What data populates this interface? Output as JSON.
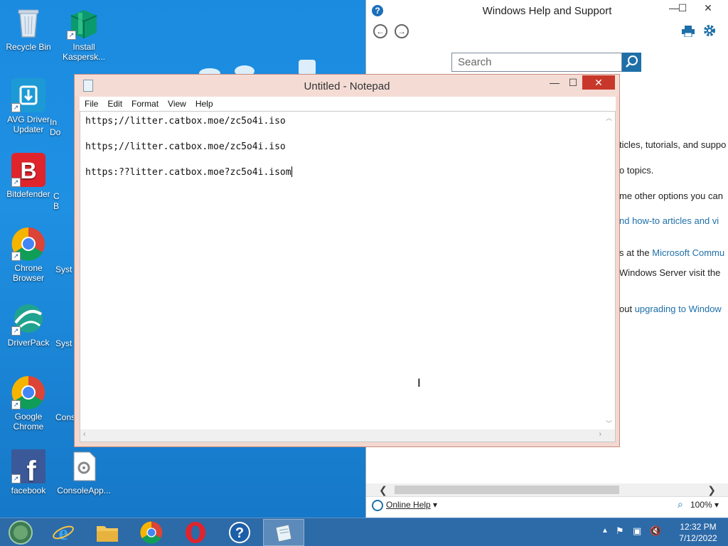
{
  "desktop": {
    "icons": [
      {
        "label": "Recycle Bin",
        "icon": "recycle-bin-icon"
      },
      {
        "label": "Install Kaspersk...",
        "icon": "kaspersky-box-icon"
      },
      {
        "label": "AVG Driver Updater",
        "icon": "avg-driver-updater-icon"
      },
      {
        "label": "Bitdefender",
        "icon": "bitdefender-icon"
      },
      {
        "label": "Chrone Browser",
        "icon": "chrome-icon"
      },
      {
        "label": "DriverPack",
        "icon": "driverpack-icon"
      },
      {
        "label": "Google Chrome",
        "icon": "chrome-icon"
      },
      {
        "label": "facebook",
        "icon": "facebook-icon"
      },
      {
        "label": "ConsoleApp...",
        "icon": "console-app-icon"
      }
    ],
    "partial_labels": [
      "In",
      "Do",
      "C",
      "B",
      "Syst",
      "Syst",
      "Conso"
    ]
  },
  "help_window": {
    "title": "Windows Help and Support",
    "search_placeholder": "Search",
    "lines": [
      {
        "pre": "ticles, tutorials, and suppo",
        "link": ""
      },
      {
        "pre": "o topics.",
        "link": ""
      },
      {
        "pre": "me other options you can",
        "link": ""
      },
      {
        "pre": "",
        "link": "nd how-to articles and vi"
      },
      {
        "pre": "s at the ",
        "link": "Microsoft Commu"
      },
      {
        "pre": "Windows Server visit the",
        "link": ""
      },
      {
        "pre": "out ",
        "link": "upgrading to Window"
      }
    ],
    "footer": {
      "online_help": "Online Help",
      "zoom": "100%"
    }
  },
  "notepad": {
    "title": "Untitled - Notepad",
    "menu": [
      "File",
      "Edit",
      "Format",
      "View",
      "Help"
    ],
    "lines": [
      "https;//litter.catbox.moe/zc5o4i.iso",
      "",
      "https;//litter.catbox.moe/zc5o4i.iso",
      "",
      "https:??litter.catbox.moe?zc5o4i.isom"
    ]
  },
  "taskbar": {
    "apps": [
      "start-icon",
      "internet-explorer-icon",
      "file-explorer-icon",
      "chrome-icon",
      "opera-icon",
      "help-icon",
      "notepad-icon"
    ],
    "clock": {
      "time": "12:32 PM",
      "date": "7/12/2022"
    }
  },
  "colors": {
    "accent": "#1e6fa8",
    "taskbar": "#2d6aa8",
    "notepad_frame": "#f2d8d0",
    "close": "#c8382a"
  }
}
